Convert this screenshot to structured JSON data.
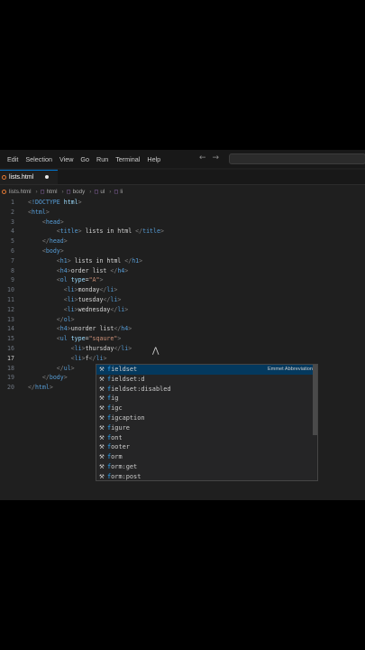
{
  "menu": [
    "Edit",
    "Selection",
    "View",
    "Go",
    "Run",
    "Terminal",
    "Help"
  ],
  "nav": {
    "back_icon": "arrow-left-icon",
    "forward_icon": "arrow-right-icon"
  },
  "tab": {
    "label": "lists.html"
  },
  "breadcrumb": [
    "lists.html",
    "html",
    "body",
    "ul",
    "li"
  ],
  "editor": {
    "line_numbers": [
      "1",
      "2",
      "3",
      "4",
      "5",
      "6",
      "7",
      "8",
      "9",
      "10",
      "11",
      "12",
      "13",
      "14",
      "15",
      "16",
      "17",
      "18",
      "19",
      "20"
    ],
    "current_line": "17",
    "lines": [
      "<!DOCTYPE html>",
      "<html>",
      "    <head>",
      "        <title> lists in html </title>",
      "    </head>",
      "    <body>",
      "        <h1> lists in html </h1>",
      "        <h4>order list </h4>",
      "        <ol type=\"A\">",
      "          <li>monday</li>",
      "          <li>tuesday</li>",
      "          <li>wednesday</li>",
      "        </ol>",
      "        <h4>unorder list</h4>",
      "        <ul type=\"sqaure\">",
      "            <li>thursday</li>",
      "            <li>f</li>",
      "        </ul>",
      "    </body>",
      "</html>"
    ]
  },
  "suggestions": {
    "typed": "f",
    "items": [
      "fieldset",
      "fieldset:d",
      "fieldset:disabled",
      "fig",
      "figc",
      "figcaption",
      "figure",
      "font",
      "footer",
      "form",
      "form:get",
      "form:post"
    ],
    "selected_detail": "Emmet Abbreviation"
  },
  "colors": {
    "accent": "#0078d4",
    "tag": "#569cd6",
    "attr": "#9cdcfe",
    "string": "#ce9178",
    "match": "#2aaaff"
  }
}
